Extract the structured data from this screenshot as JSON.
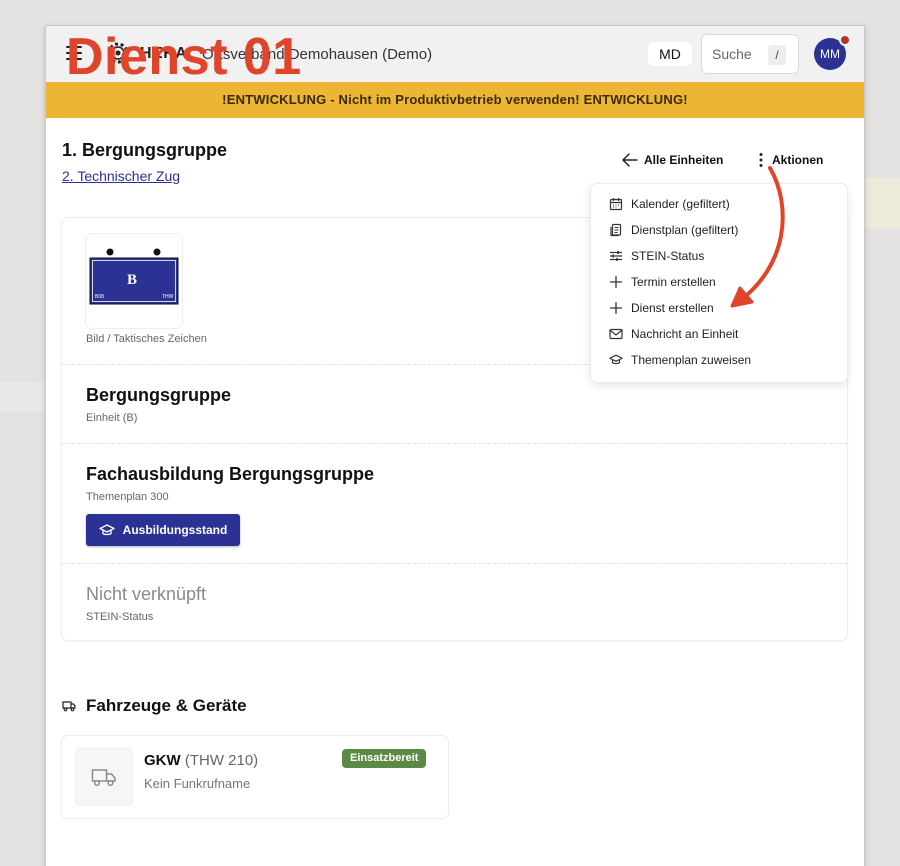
{
  "header": {
    "brand": "HERA",
    "org": "Ortsverband Demohausen (Demo)",
    "overlay_title": "Dienst 01",
    "md_chip": "MD",
    "search_placeholder": "Suche",
    "search_shortcut": "/",
    "avatar_initials": "MM"
  },
  "banner": "!ENTWICKLUNG - Nicht im Produktivbetrieb verwenden! ENTWICKLUNG!",
  "page": {
    "title": "1. Bergungsgruppe",
    "parent_link": "2. Technischer Zug",
    "back_label": "Alle Einheiten",
    "actions_label": "Aktionen"
  },
  "menu": {
    "items": [
      {
        "label": "Kalender (gefiltert)",
        "icon": "calendar-icon"
      },
      {
        "label": "Dienstplan (gefiltert)",
        "icon": "clipboard-icon"
      },
      {
        "label": "STEIN-Status",
        "icon": "sliders-icon"
      },
      {
        "label": "Termin erstellen",
        "icon": "plus-icon"
      },
      {
        "label": "Dienst erstellen",
        "icon": "plus-icon"
      },
      {
        "label": "Nachricht an Einheit",
        "icon": "mail-icon"
      },
      {
        "label": "Themenplan zuweisen",
        "icon": "graduation-cap-icon"
      }
    ]
  },
  "card": {
    "tz_letter": "B",
    "tz_left": "B08",
    "tz_right": "THW",
    "image_caption": "Bild / Taktisches Zeichen",
    "unit_name": "Bergungsgruppe",
    "unit_sub": "Einheit (B)",
    "training_name": "Fachausbildung Bergungsgruppe",
    "training_sub": "Themenplan 300",
    "training_button": "Ausbildungsstand",
    "stein_name": "Nicht verknüpft",
    "stein_sub": "STEIN-Status"
  },
  "vehicles": {
    "title": "Fahrzeuge & Geräte",
    "items": [
      {
        "name": "GKW",
        "code": "(THW 210)",
        "sub": "Kein Funkrufname",
        "status": "Einsatzbereit"
      }
    ]
  },
  "colors": {
    "brand_blue": "#2b3294",
    "banner_yellow": "#ecb534",
    "annotation_red": "#e0442a",
    "status_green": "#5c8a45"
  }
}
